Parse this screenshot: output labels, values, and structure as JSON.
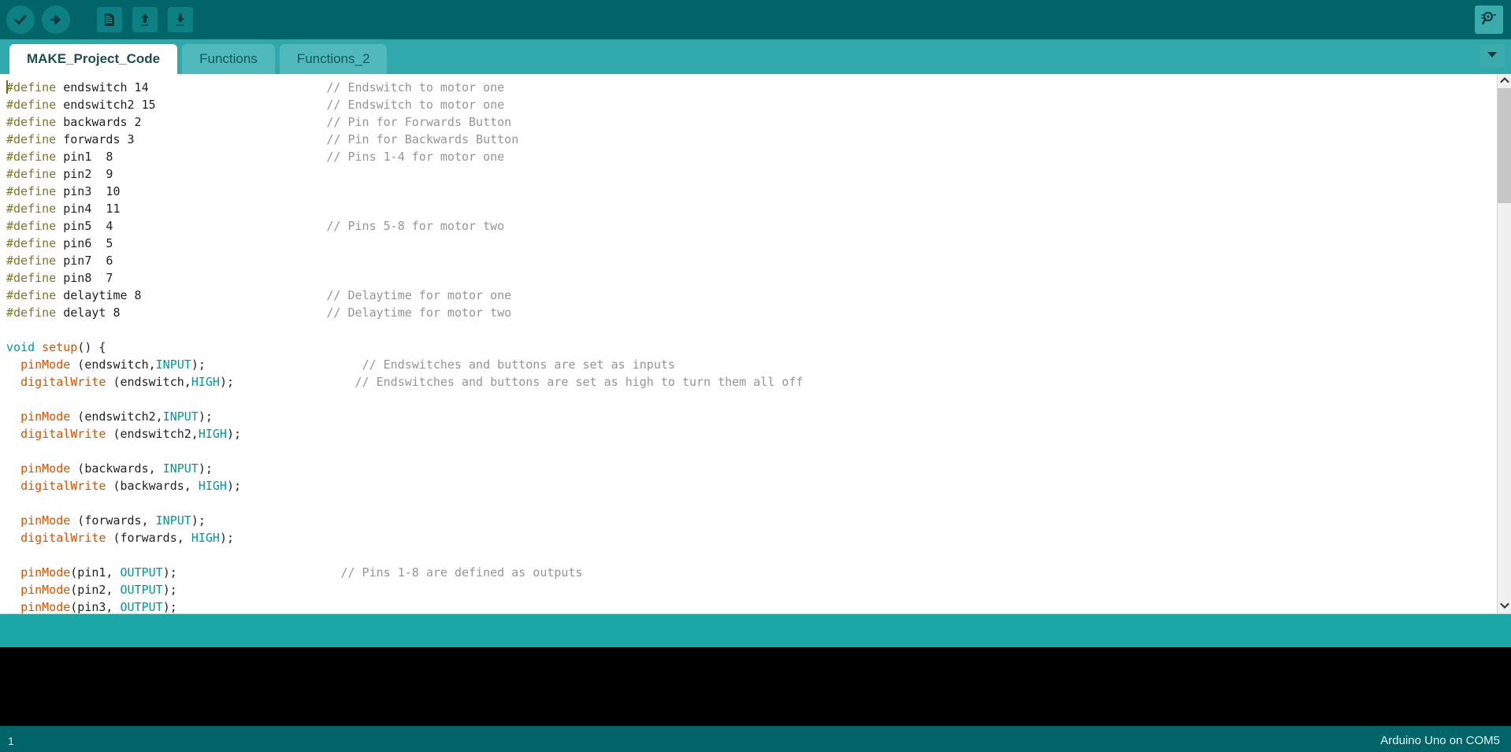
{
  "app": {
    "name": "Arduino IDE",
    "theme": {
      "toolbar_bg": "#006468",
      "tabbar_bg": "#2fa9ac",
      "tab_active_bg": "#ffffff",
      "tab_inactive_bg": "#4fb9bb",
      "console_bg": "#000000",
      "statusbar_bg": "#006468",
      "accent": "#1ba6a8"
    }
  },
  "toolbar": {
    "buttons": [
      {
        "name": "verify-button",
        "icon": "check-icon",
        "label": "Verify"
      },
      {
        "name": "upload-button",
        "icon": "arrow-right-icon",
        "label": "Upload"
      },
      {
        "name": "new-button",
        "icon": "new-document-icon",
        "label": "New"
      },
      {
        "name": "open-button",
        "icon": "arrow-up-icon",
        "label": "Open"
      },
      {
        "name": "save-button",
        "icon": "arrow-down-icon",
        "label": "Save"
      }
    ],
    "serial_monitor": {
      "name": "serial-monitor-button",
      "icon": "magnifier-icon",
      "label": "Serial Monitor"
    }
  },
  "tabs": {
    "items": [
      {
        "label": "MAKE_Project_Code",
        "active": true
      },
      {
        "label": "Functions",
        "active": false
      },
      {
        "label": "Functions_2",
        "active": false
      }
    ],
    "overflow_icon": "chevron-down-icon"
  },
  "editor": {
    "lines": [
      [
        {
          "t": "#define",
          "c": "define"
        },
        {
          "t": " endswitch 14",
          "c": "plain"
        },
        {
          "t": "                         ",
          "c": "plain"
        },
        {
          "t": "// Endswitch to motor one",
          "c": "cmt"
        }
      ],
      [
        {
          "t": "#define",
          "c": "define"
        },
        {
          "t": " endswitch2 15",
          "c": "plain"
        },
        {
          "t": "                        ",
          "c": "plain"
        },
        {
          "t": "// Endswitch to motor one",
          "c": "cmt"
        }
      ],
      [
        {
          "t": "#define",
          "c": "define"
        },
        {
          "t": " backwards 2",
          "c": "plain"
        },
        {
          "t": "                          ",
          "c": "plain"
        },
        {
          "t": "// Pin for Forwards Button",
          "c": "cmt"
        }
      ],
      [
        {
          "t": "#define",
          "c": "define"
        },
        {
          "t": " forwards 3",
          "c": "plain"
        },
        {
          "t": "                           ",
          "c": "plain"
        },
        {
          "t": "// Pin for Backwards Button",
          "c": "cmt"
        }
      ],
      [
        {
          "t": "#define",
          "c": "define"
        },
        {
          "t": " pin1  8",
          "c": "plain"
        },
        {
          "t": "                              ",
          "c": "plain"
        },
        {
          "t": "// Pins 1-4 for motor one",
          "c": "cmt"
        }
      ],
      [
        {
          "t": "#define",
          "c": "define"
        },
        {
          "t": " pin2  9",
          "c": "plain"
        }
      ],
      [
        {
          "t": "#define",
          "c": "define"
        },
        {
          "t": " pin3  10",
          "c": "plain"
        }
      ],
      [
        {
          "t": "#define",
          "c": "define"
        },
        {
          "t": " pin4  11",
          "c": "plain"
        }
      ],
      [
        {
          "t": "#define",
          "c": "define"
        },
        {
          "t": " pin5  4",
          "c": "plain"
        },
        {
          "t": "                              ",
          "c": "plain"
        },
        {
          "t": "// Pins 5-8 for motor two",
          "c": "cmt"
        }
      ],
      [
        {
          "t": "#define",
          "c": "define"
        },
        {
          "t": " pin6  5",
          "c": "plain"
        }
      ],
      [
        {
          "t": "#define",
          "c": "define"
        },
        {
          "t": " pin7  6",
          "c": "plain"
        }
      ],
      [
        {
          "t": "#define",
          "c": "define"
        },
        {
          "t": " pin8  7",
          "c": "plain"
        }
      ],
      [
        {
          "t": "#define",
          "c": "define"
        },
        {
          "t": " delaytime 8",
          "c": "plain"
        },
        {
          "t": "                          ",
          "c": "plain"
        },
        {
          "t": "// Delaytime for motor one",
          "c": "cmt"
        }
      ],
      [
        {
          "t": "#define",
          "c": "define"
        },
        {
          "t": " delayt 8",
          "c": "plain"
        },
        {
          "t": "                             ",
          "c": "plain"
        },
        {
          "t": "// Delaytime for motor two",
          "c": "cmt"
        }
      ],
      [
        {
          "t": "",
          "c": "plain"
        }
      ],
      [
        {
          "t": "void",
          "c": "type"
        },
        {
          "t": " ",
          "c": "plain"
        },
        {
          "t": "setup",
          "c": "func"
        },
        {
          "t": "() {",
          "c": "plain"
        }
      ],
      [
        {
          "t": "  ",
          "c": "plain"
        },
        {
          "t": "pinMode",
          "c": "func"
        },
        {
          "t": " (endswitch,",
          "c": "plain"
        },
        {
          "t": "INPUT",
          "c": "const"
        },
        {
          "t": ");",
          "c": "plain"
        },
        {
          "t": "                      ",
          "c": "plain"
        },
        {
          "t": "// Endswitches and buttons are set as inputs",
          "c": "cmt"
        }
      ],
      [
        {
          "t": "  ",
          "c": "plain"
        },
        {
          "t": "digitalWrite",
          "c": "func"
        },
        {
          "t": " (endswitch,",
          "c": "plain"
        },
        {
          "t": "HIGH",
          "c": "const"
        },
        {
          "t": ");",
          "c": "plain"
        },
        {
          "t": "                 ",
          "c": "plain"
        },
        {
          "t": "// Endswitches and buttons are set as high to turn them all off",
          "c": "cmt"
        }
      ],
      [
        {
          "t": "",
          "c": "plain"
        }
      ],
      [
        {
          "t": "  ",
          "c": "plain"
        },
        {
          "t": "pinMode",
          "c": "func"
        },
        {
          "t": " (endswitch2,",
          "c": "plain"
        },
        {
          "t": "INPUT",
          "c": "const"
        },
        {
          "t": ");",
          "c": "plain"
        }
      ],
      [
        {
          "t": "  ",
          "c": "plain"
        },
        {
          "t": "digitalWrite",
          "c": "func"
        },
        {
          "t": " (endswitch2,",
          "c": "plain"
        },
        {
          "t": "HIGH",
          "c": "const"
        },
        {
          "t": ");",
          "c": "plain"
        }
      ],
      [
        {
          "t": "",
          "c": "plain"
        }
      ],
      [
        {
          "t": "  ",
          "c": "plain"
        },
        {
          "t": "pinMode",
          "c": "func"
        },
        {
          "t": " (backwards, ",
          "c": "plain"
        },
        {
          "t": "INPUT",
          "c": "const"
        },
        {
          "t": ");",
          "c": "plain"
        }
      ],
      [
        {
          "t": "  ",
          "c": "plain"
        },
        {
          "t": "digitalWrite",
          "c": "func"
        },
        {
          "t": " (backwards, ",
          "c": "plain"
        },
        {
          "t": "HIGH",
          "c": "const"
        },
        {
          "t": ");",
          "c": "plain"
        }
      ],
      [
        {
          "t": "",
          "c": "plain"
        }
      ],
      [
        {
          "t": "  ",
          "c": "plain"
        },
        {
          "t": "pinMode",
          "c": "func"
        },
        {
          "t": " (forwards, ",
          "c": "plain"
        },
        {
          "t": "INPUT",
          "c": "const"
        },
        {
          "t": ");",
          "c": "plain"
        }
      ],
      [
        {
          "t": "  ",
          "c": "plain"
        },
        {
          "t": "digitalWrite",
          "c": "func"
        },
        {
          "t": " (forwards, ",
          "c": "plain"
        },
        {
          "t": "HIGH",
          "c": "const"
        },
        {
          "t": ");",
          "c": "plain"
        }
      ],
      [
        {
          "t": "",
          "c": "plain"
        }
      ],
      [
        {
          "t": "  ",
          "c": "plain"
        },
        {
          "t": "pinMode",
          "c": "func"
        },
        {
          "t": "(pin1, ",
          "c": "plain"
        },
        {
          "t": "OUTPUT",
          "c": "const"
        },
        {
          "t": ");",
          "c": "plain"
        },
        {
          "t": "                       ",
          "c": "plain"
        },
        {
          "t": "// Pins 1-8 are defined as outputs",
          "c": "cmt"
        }
      ],
      [
        {
          "t": "  ",
          "c": "plain"
        },
        {
          "t": "pinMode",
          "c": "func"
        },
        {
          "t": "(pin2, ",
          "c": "plain"
        },
        {
          "t": "OUTPUT",
          "c": "const"
        },
        {
          "t": ");",
          "c": "plain"
        }
      ],
      [
        {
          "t": "  ",
          "c": "plain"
        },
        {
          "t": "pinMode",
          "c": "func"
        },
        {
          "t": "(pin3, ",
          "c": "plain"
        },
        {
          "t": "OUTPUT",
          "c": "const"
        },
        {
          "t": ");",
          "c": "plain"
        }
      ]
    ],
    "caret_visible": true
  },
  "console": {
    "text": ""
  },
  "statusbar": {
    "line_number": "1",
    "board": "Arduino Uno on COM5"
  }
}
